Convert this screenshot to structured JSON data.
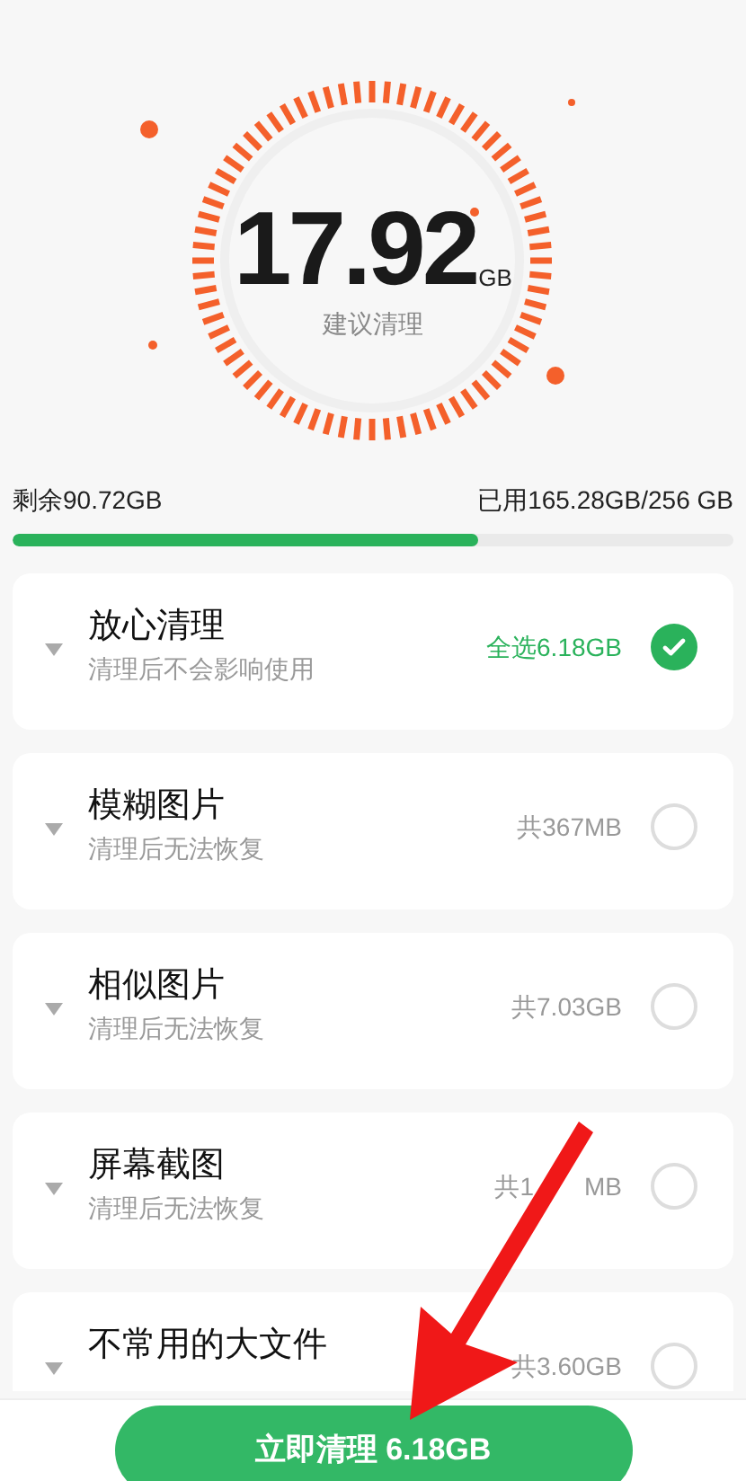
{
  "summary": {
    "amount": "17.92",
    "unit": "GB",
    "caption": "建议清理"
  },
  "storage": {
    "free": "剩余90.72GB",
    "used": "已用165.28GB/256 GB",
    "level": 0.646
  },
  "items": [
    {
      "title": "放心清理",
      "subtitle": "清理后不会影响使用",
      "size": [
        "全选6.18GB"
      ],
      "checked": true
    },
    {
      "title": "模糊图片",
      "subtitle": "清理后无法恢复",
      "size": [
        "共367MB"
      ],
      "checked": false
    },
    {
      "title": "相似图片",
      "subtitle": "清理后无法恢复",
      "size": [
        "共7.03GB"
      ],
      "checked": false
    },
    {
      "title": "屏幕截图",
      "subtitle": "清理后无法恢复",
      "size": [
        "共1",
        "MB"
      ],
      "checked": false
    },
    {
      "title": "不常用的大文件",
      "size": [
        "共3.60GB"
      ],
      "checked": false
    }
  ],
  "clean_button": "立即清理 6.18GB"
}
